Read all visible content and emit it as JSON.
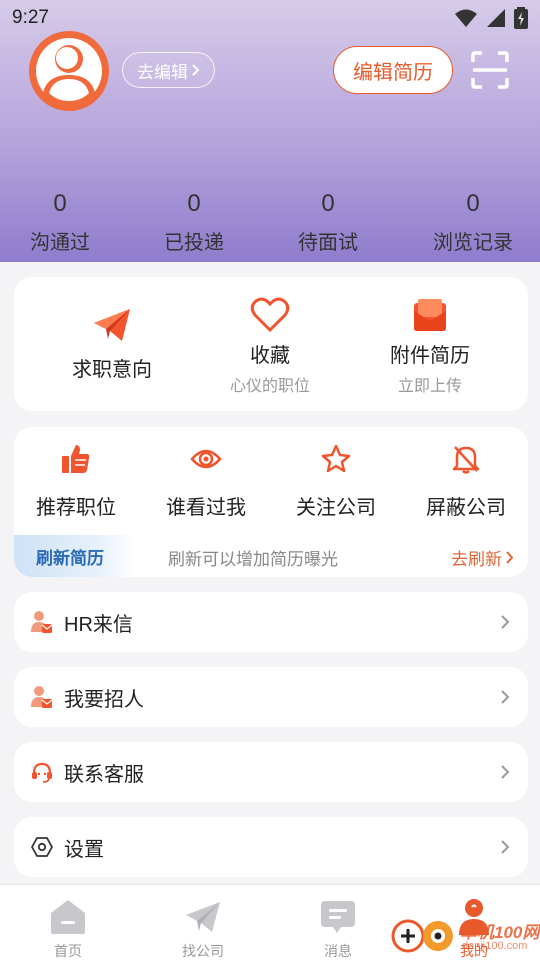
{
  "status_bar": {
    "time": "9:27"
  },
  "profile": {
    "edit_link": "去编辑",
    "edit_resume_button": "编辑简历"
  },
  "stats": [
    {
      "value": "0",
      "label": "沟通过"
    },
    {
      "value": "0",
      "label": "已投递"
    },
    {
      "value": "0",
      "label": "待面试"
    },
    {
      "value": "0",
      "label": "浏览记录"
    }
  ],
  "quick_actions": {
    "job_intent": {
      "title": "求职意向",
      "icon": "paper-plane-icon"
    },
    "favorites": {
      "title": "收藏",
      "subtitle": "心仪的职位",
      "icon": "heart-icon"
    },
    "attachment_resume": {
      "title": "附件简历",
      "subtitle": "立即上传",
      "icon": "envelope-icon"
    }
  },
  "tools": [
    {
      "label": "推荐职位",
      "icon": "thumbs-up-icon"
    },
    {
      "label": "谁看过我",
      "icon": "eye-icon"
    },
    {
      "label": "关注公司",
      "icon": "star-icon"
    },
    {
      "label": "屏蔽公司",
      "icon": "bell-off-icon"
    }
  ],
  "refresh": {
    "tag": "刷新简历",
    "description": "刷新可以增加简历曝光",
    "action": "去刷新"
  },
  "menu": [
    {
      "label": "HR来信",
      "icon": "person-mail-icon"
    },
    {
      "label": "我要招人",
      "icon": "person-mail-icon"
    },
    {
      "label": "联系客服",
      "icon": "headset-icon"
    },
    {
      "label": "设置",
      "icon": "hexagon-settings-icon"
    }
  ],
  "tabbar": [
    {
      "label": "首页",
      "icon": "home-icon"
    },
    {
      "label": "找公司",
      "icon": "paper-plane-icon"
    },
    {
      "label": "消息",
      "icon": "chat-icon"
    },
    {
      "label": "我的",
      "icon": "person-icon"
    }
  ],
  "watermark": {
    "brand": "单机100网",
    "url": "danji100.com"
  },
  "colors": {
    "accent": "#e85a2c",
    "header_gradient_end": "#8f7ccc",
    "refresh_blue": "#2a6bb7"
  }
}
